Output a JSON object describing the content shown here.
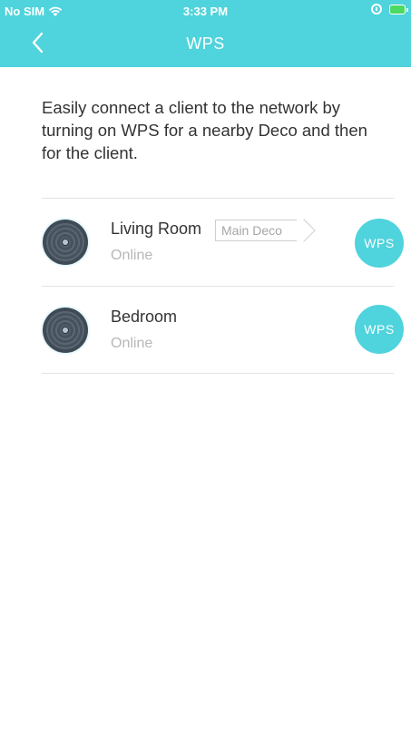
{
  "status_bar": {
    "carrier": "No SIM",
    "time": "3:33 PM",
    "icons": [
      "wifi-icon",
      "orientation-lock-icon",
      "battery-charging-icon"
    ]
  },
  "nav": {
    "title": "WPS",
    "back_icon": "chevron-left-icon"
  },
  "intro_text": "Easily connect a client to the network by turning on WPS for a nearby Deco and then for the client.",
  "devices": [
    {
      "name": "Living Room",
      "badge": "Main Deco",
      "status": "Online",
      "button_label": "WPS"
    },
    {
      "name": "Bedroom",
      "status": "Online",
      "button_label": "WPS"
    }
  ],
  "colors": {
    "accent": "#4fd3dc",
    "text": "#333333",
    "muted": "#b7b7b7"
  }
}
